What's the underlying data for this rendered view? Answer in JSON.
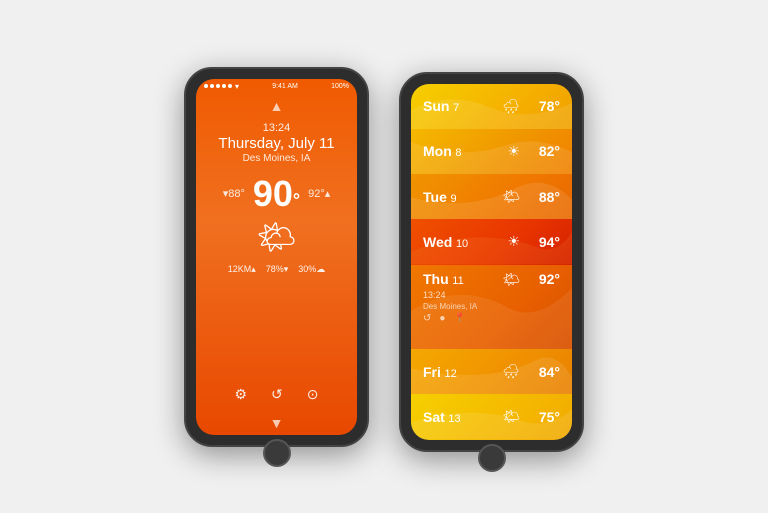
{
  "left_phone": {
    "status": {
      "signal": "●●●●●",
      "wifi": "▾",
      "time": "9:41 AM",
      "battery": "100%"
    },
    "nav_up": "▲",
    "nav_down": "▼",
    "time": "13:24",
    "day": "Thursday, July 11",
    "location": "Des Moines, IA",
    "temp_low": "▾88°",
    "temp_main": "90",
    "temp_high": "92°▴",
    "weather_icon": "🌤",
    "stats": [
      "12KM▴",
      "78%▾",
      "30%☁"
    ],
    "bottom_nav": [
      "⚙",
      "↺",
      "⊙"
    ]
  },
  "right_phone": {
    "forecast": [
      {
        "day": "Sun",
        "num": "7",
        "icon": "🌧",
        "temp": "78°",
        "bg": "#f5c200",
        "gradient": "linear-gradient(135deg, #f5c200 0%, #f0a800 100%)"
      },
      {
        "day": "Mon",
        "num": "8",
        "icon": "☀",
        "temp": "82°",
        "bg": "#f5a800",
        "gradient": "linear-gradient(135deg, #f5b800 0%, #f09000 100%)"
      },
      {
        "day": "Tue",
        "num": "9",
        "icon": "🌤",
        "temp": "88°",
        "bg": "#f07800",
        "gradient": "linear-gradient(135deg, #f09000 0%, #f07800 100%)"
      },
      {
        "day": "Wed",
        "num": "10",
        "icon": "☀",
        "temp": "94°",
        "bg": "#e84800",
        "gradient": "linear-gradient(135deg, #f05000 0%, #e83000 100%)",
        "active_color": "red"
      },
      {
        "day": "Thu",
        "num": "11",
        "icon": "🌤",
        "temp": "92°",
        "bg": "#f07020",
        "gradient": "linear-gradient(135deg, #f07800 0%, #e86000 100%)",
        "is_current": true,
        "time": "13:24",
        "location": "Des Moines, IA",
        "sub_icons": [
          "↺",
          "⊙",
          "⊕"
        ]
      },
      {
        "day": "Fri",
        "num": "12",
        "icon": "🌧",
        "temp": "84°",
        "bg": "#f5a000",
        "gradient": "linear-gradient(135deg, #f5a800 0%, #f09000 100%)"
      },
      {
        "day": "Sat",
        "num": "13",
        "icon": "🌤",
        "temp": "75°",
        "bg": "#f5c800",
        "gradient": "linear-gradient(135deg, #f5d000 0%, #f5b000 100%)"
      }
    ]
  }
}
